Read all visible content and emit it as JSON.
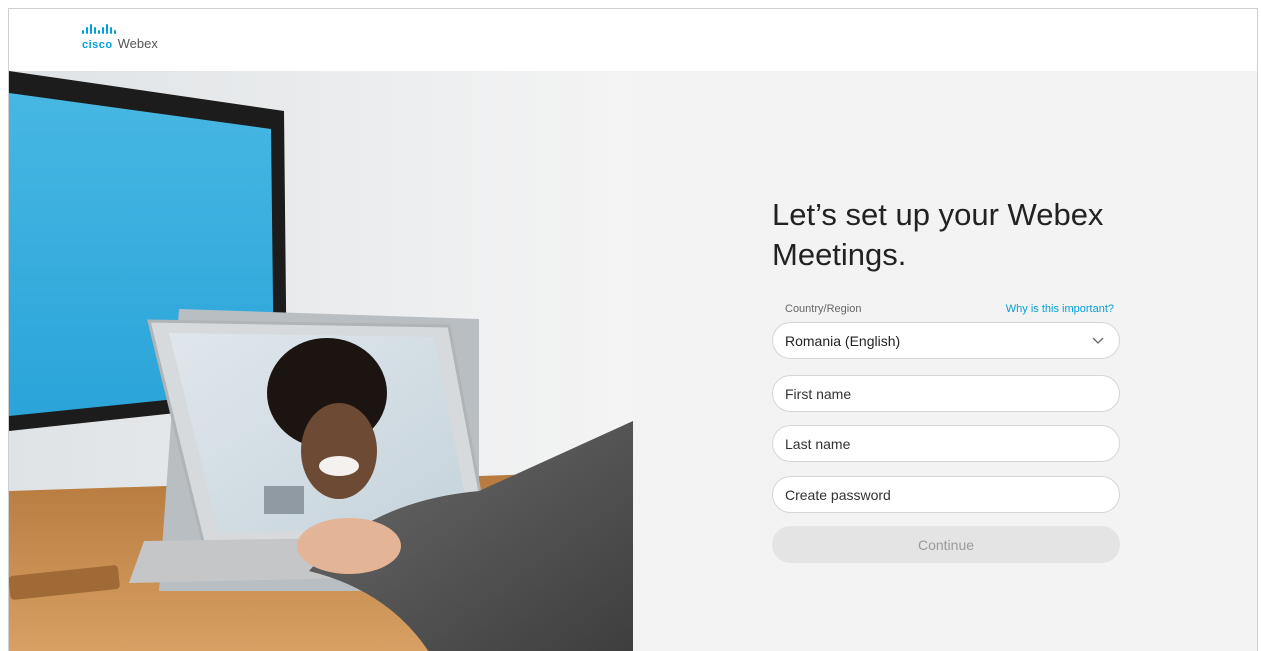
{
  "brand": {
    "company": "cisco",
    "product": "Webex",
    "accent_color": "#049fd9"
  },
  "form": {
    "title": "Let’s set up your Webex Meetings.",
    "country_label": "Country/Region",
    "why_link": "Why is this important?",
    "country_value": "Romania (English)",
    "first_name_placeholder": "First name",
    "last_name_placeholder": "Last name",
    "password_placeholder": "Create password",
    "continue_label": "Continue"
  },
  "icons": {
    "logo": "cisco-logo-icon",
    "dropdown": "chevron-down-icon"
  }
}
